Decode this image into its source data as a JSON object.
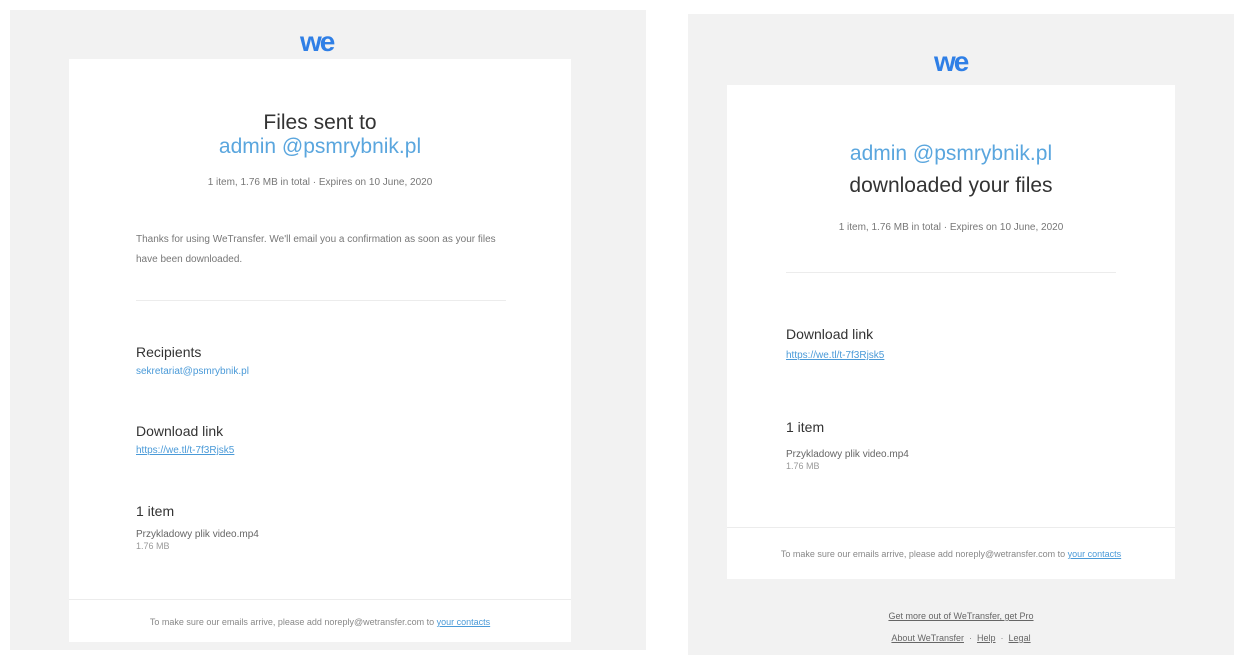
{
  "left": {
    "logo": "we",
    "title": "Files sent to",
    "email": "admin @psmrybnik.pl",
    "meta": "1 item, 1.76 MB in total  ·  Expires on 10 June, 2020",
    "message": "Thanks for using WeTransfer. We'll email you a confirmation as soon as your files have been downloaded.",
    "recipients_heading": "Recipients",
    "recipient": "sekretariat@psmrybnik.pl",
    "download_heading": "Download link",
    "download_url": "https://we.tl/t-7f3Rjsk5",
    "items_heading": "1 item",
    "file_name": "Przykladowy plik video.mp4",
    "file_size": "1.76 MB",
    "footer_text": "To make sure our emails arrive, please add noreply@wetransfer.com to",
    "footer_link": "your contacts"
  },
  "right": {
    "logo": "we",
    "email": "admin @psmrybnik.pl",
    "title": "downloaded your files",
    "meta": "1 item, 1.76 MB in total  ·  Expires on 10 June, 2020",
    "download_heading": "Download link",
    "download_url": "https://we.tl/t-7f3Rjsk5",
    "items_heading": "1 item",
    "file_name": "Przykladowy plik video.mp4",
    "file_size": "1.76 MB",
    "footer_text": "To make sure our emails arrive, please add noreply@wetransfer.com to",
    "footer_link": "your contacts",
    "get_more": "Get more out of WeTransfer, get Pro",
    "about": "About WeTransfer",
    "help": "Help",
    "legal": "Legal",
    "separator": "·"
  }
}
